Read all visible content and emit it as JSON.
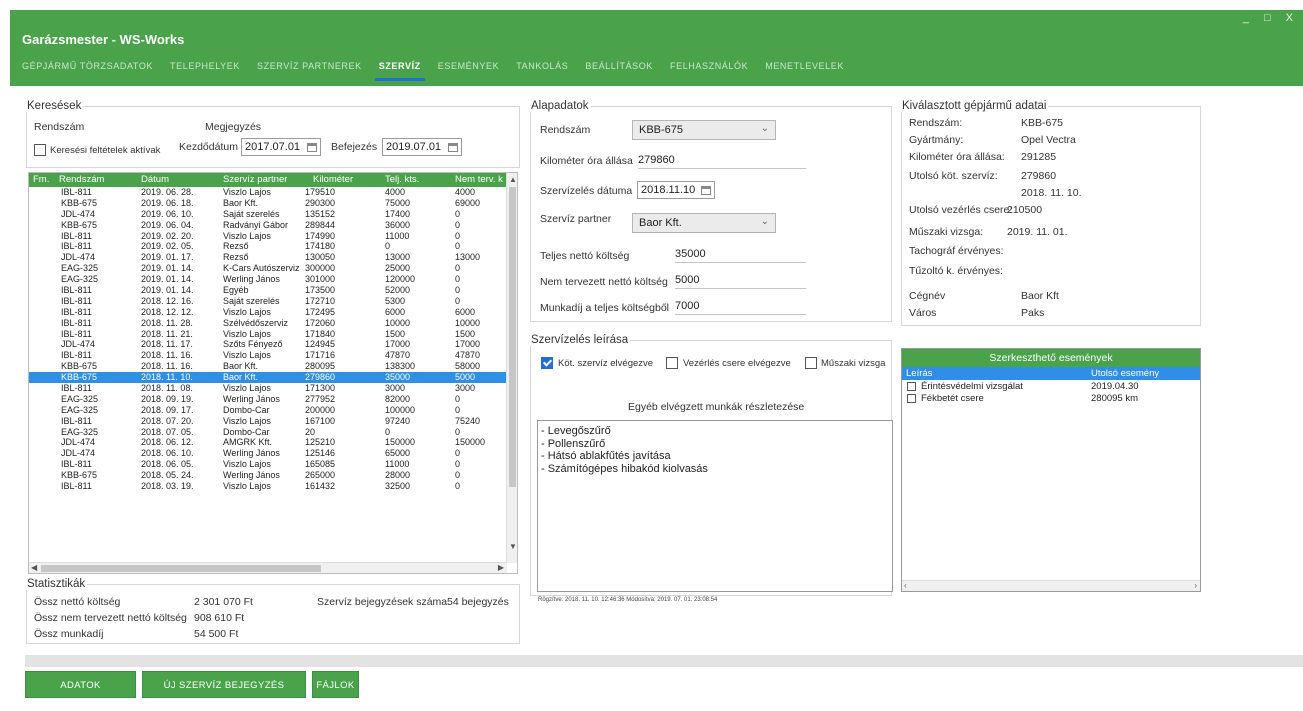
{
  "app": {
    "title": "Garázsmester - WS-Works",
    "window_controls": "_ □ X"
  },
  "nav": [
    "GÉPJÁRMŰ TÖRZSADATOK",
    "TELEPHELYEK",
    "SZERVÍZ PARTNEREK",
    "SZERVÍZ",
    "ESEMÉNYEK",
    "TANKOLÁS",
    "BEÁLLÍTÁSOK",
    "FELHASZNÁLÓK",
    "MENETLEVELEK"
  ],
  "search": {
    "legend": "Keresések",
    "rendszam_label": "Rendszám",
    "megjegyzes_label": "Megjegyzés",
    "active_label": "Keresési feltételek aktívak",
    "start_label": "Kezdődátum",
    "start_value": "2017.07.01",
    "end_label": "Befejezés",
    "end_value": "2019.07.01"
  },
  "grid": {
    "columns": [
      "Fm.",
      "Rendszám",
      "Dátum",
      "Szervíz partner",
      "Kilométer",
      "Telj. kts.",
      "Nem terv. k"
    ],
    "rows": [
      [
        "IBL-811",
        "2019. 06. 28.",
        "Viszlo Lajos",
        "179510",
        "4000",
        "4000"
      ],
      [
        "KBB-675",
        "2019. 06. 18.",
        "Baor Kft.",
        "290300",
        "75000",
        "69000"
      ],
      [
        "JDL-474",
        "2019. 06. 10.",
        "Saját szerelés",
        "135152",
        "17400",
        "0"
      ],
      [
        "KBB-675",
        "2019. 06. 04.",
        "Radványi Gábor",
        "289844",
        "36000",
        "0"
      ],
      [
        "IBL-811",
        "2019. 02. 20.",
        "Viszlo Lajos",
        "174990",
        "11000",
        "0"
      ],
      [
        "IBL-811",
        "2019. 02. 05.",
        "Rezső",
        "174180",
        "0",
        "0"
      ],
      [
        "JDL-474",
        "2019. 01. 17.",
        "Rezső",
        "130050",
        "13000",
        "13000"
      ],
      [
        "EAG-325",
        "2019. 01. 14.",
        "K-Cars Autószerviz",
        "300000",
        "25000",
        "0"
      ],
      [
        "EAG-325",
        "2019. 01. 14.",
        "Werling János",
        "301000",
        "120000",
        "0"
      ],
      [
        "IBL-811",
        "2019. 01. 14.",
        "Egyéb",
        "173500",
        "52000",
        "0"
      ],
      [
        "IBL-811",
        "2018. 12. 16.",
        "Saját szerelés",
        "172710",
        "5300",
        "0"
      ],
      [
        "IBL-811",
        "2018. 12. 12.",
        "Viszlo Lajos",
        "172495",
        "6000",
        "6000"
      ],
      [
        "IBL-811",
        "2018. 11. 28.",
        "Szélvédőszerviz",
        "172060",
        "10000",
        "10000"
      ],
      [
        "IBL-811",
        "2018. 11. 21.",
        "Viszlo Lajos",
        "171840",
        "1500",
        "1500"
      ],
      [
        "JDL-474",
        "2018. 11. 17.",
        "Szőts Fényező",
        "124945",
        "17000",
        "17000"
      ],
      [
        "IBL-811",
        "2018. 11. 16.",
        "Viszlo Lajos",
        "171716",
        "47870",
        "47870"
      ],
      [
        "KBB-675",
        "2018. 11. 16.",
        "Baor Kft.",
        "280095",
        "138300",
        "58000"
      ],
      [
        "KBB-675",
        "2018. 11. 10.",
        "Baor Kft.",
        "279860",
        "35000",
        "5000"
      ],
      [
        "IBL-811",
        "2018. 11. 08.",
        "Viszlo Lajos",
        "171300",
        "3000",
        "3000"
      ],
      [
        "EAG-325",
        "2018. 09. 19.",
        "Werling János",
        "277952",
        "82000",
        "0"
      ],
      [
        "EAG-325",
        "2018. 09. 17.",
        "Dombo-Car",
        "200000",
        "100000",
        "0"
      ],
      [
        "IBL-811",
        "2018. 07. 20.",
        "Viszlo Lajos",
        "167100",
        "97240",
        "75240"
      ],
      [
        "EAG-325",
        "2018. 07. 05.",
        "Dombo-Car",
        "20",
        "0",
        "0"
      ],
      [
        "JDL-474",
        "2018. 06. 12.",
        "AMGRK Kft.",
        "125210",
        "150000",
        "150000"
      ],
      [
        "JDL-474",
        "2018. 06. 10.",
        "Werling János",
        "125146",
        "65000",
        "0"
      ],
      [
        "IBL-811",
        "2018. 06. 05.",
        "Viszlo Lajos",
        "165085",
        "11000",
        "0"
      ],
      [
        "KBB-675",
        "2018. 05. 24.",
        "Werling János",
        "265000",
        "28000",
        "0"
      ],
      [
        "IBL-811",
        "2018. 03. 19.",
        "Viszlo Lajos",
        "161432",
        "32500",
        "0"
      ]
    ],
    "selected_row": 17
  },
  "stats": {
    "legend": "Statisztikák",
    "items": [
      {
        "label": "Össz nettó költség",
        "value": "2 301 070 Ft"
      },
      {
        "label": "Össz nem tervezett nettó költség",
        "value": "908 610 Ft"
      },
      {
        "label": "Össz munkadíj",
        "value": "54 500 Ft"
      }
    ],
    "count_label": "Szervíz bejegyzések száma",
    "count_value": "54 bejegyzés"
  },
  "basic": {
    "legend": "Alapadatok",
    "rendszam_label": "Rendszám",
    "rendszam_value": "KBB-675",
    "km_label": "Kilométer óra állása",
    "km_value": "279860",
    "date_label": "Szervízelés dátuma",
    "date_value": "2018.11.10",
    "partner_label": "Szervíz partner",
    "partner_value": "Baor Kft.",
    "total_label": "Teljes nettó költség",
    "total_value": "35000",
    "unplanned_label": "Nem tervezett nettó költség",
    "unplanned_value": "5000",
    "labor_label": "Munkadíj a teljes költségből",
    "labor_value": "7000"
  },
  "vehicle": {
    "legend": "Kiválasztott gépjármű adatai",
    "rows": [
      {
        "label": "Rendszám:",
        "value": "KBB-675"
      },
      {
        "label": "Gyártmány:",
        "value": "Opel Vectra"
      },
      {
        "label": "Kilométer óra állása:",
        "value": "291285"
      },
      {
        "label": "Utolsó köt. szervíz:",
        "value": "279860"
      },
      {
        "label": "",
        "value": "2018. 11. 10."
      },
      {
        "label": "Utolsó vezérlés csere:",
        "value": "210500"
      },
      {
        "label": "Műszaki vizsga:",
        "value": "2019. 11. 01."
      },
      {
        "label": "Tachográf érvényes:",
        "value": ""
      },
      {
        "label": "Tűzoltó k. érvényes:",
        "value": ""
      },
      {
        "label": "Cégnév",
        "value": "Baor Kft"
      },
      {
        "label": "Város",
        "value": "Paks"
      }
    ]
  },
  "desc": {
    "legend": "Szervízelés leírása",
    "checks": [
      {
        "label": "Köt. szervíz elvégezve",
        "checked": true
      },
      {
        "label": "Vezérlés csere elvégezve",
        "checked": false
      },
      {
        "label": "Műszaki vizsga",
        "checked": false
      }
    ],
    "other_title": "Egyéb elvégzett munkák részletezése",
    "notes": [
      "- Levegőszűrő",
      "- Pollenszűrő",
      "- Hátsó ablakfűtés javítása",
      "- Számítógépes hibakód kiolvasás"
    ],
    "recorded": "Rögzítve:   2018. 11. 10. 12:46:36    Módosítva:   2019. 07. 01. 23:08:54"
  },
  "events": {
    "title": "Szerkeszthető események",
    "col_desc": "Leírás",
    "col_last": "Utolsó esemény",
    "rows": [
      {
        "label": "Érintésvédelmi vizsgálat",
        "value": "2019.04.30"
      },
      {
        "label": "Fékbetét csere",
        "value": "280095 km"
      }
    ]
  },
  "buttons": [
    "ADATOK MÓDOSÍTÁSA",
    "ÚJ SZERVÍZ BEJEGYZÉS FELVÉTELE",
    "FÁJLOK"
  ],
  "colors": {
    "accent": "#4aa34b",
    "selection": "#2f8ee6"
  }
}
